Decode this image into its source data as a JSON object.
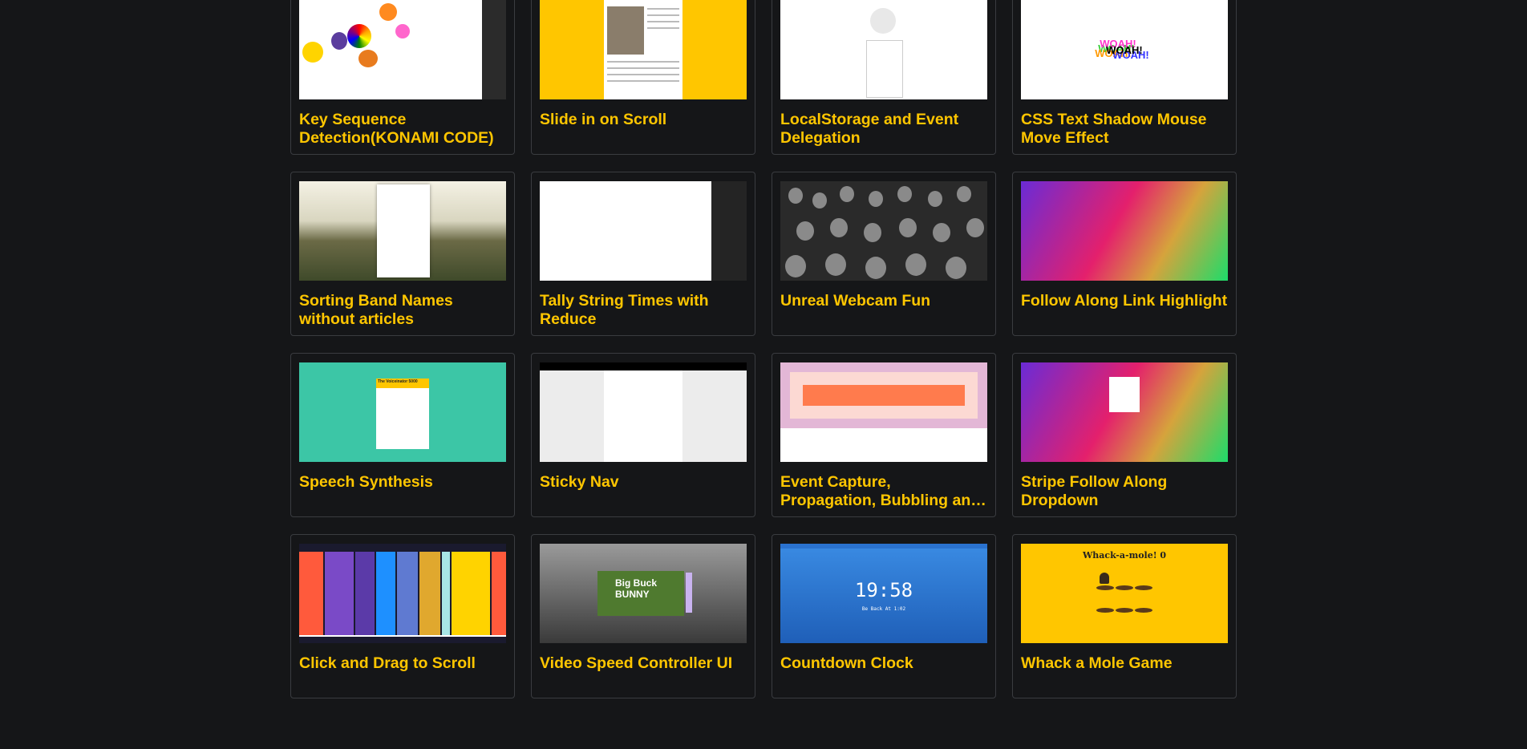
{
  "projects": [
    {
      "title": "Key Sequence Detection(KONAMI CODE)",
      "thumb": "konami"
    },
    {
      "title": "Slide in on Scroll",
      "thumb": "slide"
    },
    {
      "title": "LocalStorage and Event Delegation",
      "thumb": "storage"
    },
    {
      "title": "CSS Text Shadow Mouse Move Effect",
      "thumb": "shadow",
      "thumb_text": "WOAH!"
    },
    {
      "title": "Sorting Band Names without articles",
      "thumb": "band"
    },
    {
      "title": "Tally String Times with Reduce",
      "thumb": "tally"
    },
    {
      "title": "Unreal Webcam Fun",
      "thumb": "webcam"
    },
    {
      "title": "Follow Along Link Highlight",
      "thumb": "follow"
    },
    {
      "title": "Speech Synthesis",
      "thumb": "speech",
      "thumb_text": "The Voiceinator 5000"
    },
    {
      "title": "Sticky Nav",
      "thumb": "sticky"
    },
    {
      "title": "Event Capture, Propagation, Bubbling and Once",
      "thumb": "capture"
    },
    {
      "title": "Stripe Follow Along Dropdown",
      "thumb": "stripe"
    },
    {
      "title": "Click and Drag to Scroll",
      "thumb": "drag"
    },
    {
      "title": "Video Speed Controller UI",
      "thumb": "video",
      "thumb_text": "Big Buck BUNNY"
    },
    {
      "title": "Countdown Clock",
      "thumb": "countdown",
      "thumb_text": "19:58",
      "thumb_subtext": "Be Back At 1:02"
    },
    {
      "title": "Whack a Mole Game",
      "thumb": "mole",
      "thumb_text": "Whack-a-mole! 0"
    }
  ],
  "colors": {
    "background": "#151618",
    "accent": "#ffc600",
    "card_border": "#3a3c40"
  }
}
